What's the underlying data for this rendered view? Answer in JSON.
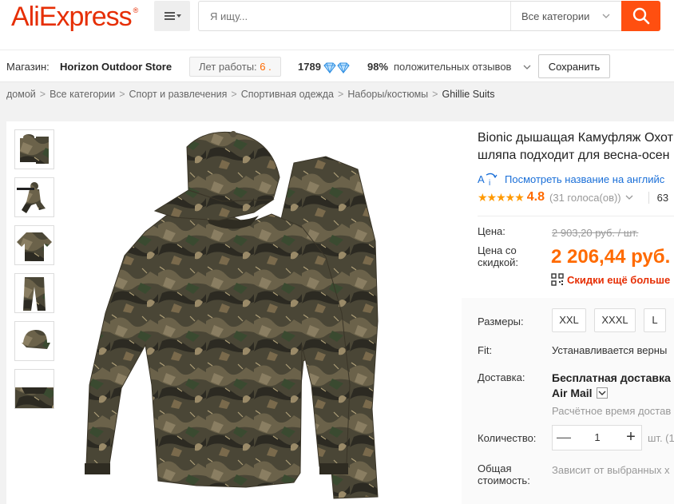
{
  "header": {
    "logo": "AliExpress",
    "logo_reg": "®",
    "search_placeholder": "Я ищу...",
    "all_categories": "Все категории",
    "brand_color": "#e62e04",
    "search_btn_color": "#ff4f10"
  },
  "store": {
    "label": "Магазин:",
    "name": "Horizon Outdoor Store",
    "years_label": "Лет работы:",
    "years_value": "6 .",
    "score": "1789",
    "feedback_pct": "98%",
    "feedback_text": "положительных отзывов",
    "save_label": "Сохранить"
  },
  "breadcrumb": {
    "items": [
      "домой",
      "Все категории",
      "Спорт и развлечения",
      "Спортивная одежда",
      "Наборы/костюмы"
    ],
    "separator": ">",
    "current": "Ghillie Suits"
  },
  "product": {
    "title_line1": "Bionic дышащая Камуфляж Охот",
    "title_line2": "шляпа подходит для весна-осен",
    "translate_link": "Посмотреть название на английс",
    "stars": "★★★★★",
    "rating": "4.8",
    "votes": "(31 голоса(ов))",
    "orders": "63",
    "price_label": "Цена:",
    "old_price": "2 903,20 руб. / шт.",
    "discount_label_1": "Цена со",
    "discount_label_2": "скидкой:",
    "sale_price": "2 206,44 руб.",
    "discount_link": "Скидки ещё больше",
    "sizes_label": "Размеры:",
    "sizes": [
      "XXL",
      "XXXL",
      "L"
    ],
    "fit_label": "Fit:",
    "fit_value": "Устанавливается верны",
    "shipping_label": "Доставка:",
    "shipping_line1": "Бесплатная доставка",
    "shipping_line2": "Air Mail",
    "delivery_time": "Расчётное время достав",
    "qty_label": "Количество:",
    "qty_minus": "—",
    "qty_value": "1",
    "qty_plus": "+",
    "qty_unit": "шт. (1",
    "total_label_1": "Общая",
    "total_label_2": "стоимость:",
    "total_value": "Зависит от выбранных х",
    "accent_color": "#ff6a00"
  },
  "gallery": {
    "thumbnails": [
      "camo-suit",
      "sniper-pose",
      "camo-shirt",
      "camo-pants",
      "camo-cap",
      "camo-back"
    ]
  }
}
